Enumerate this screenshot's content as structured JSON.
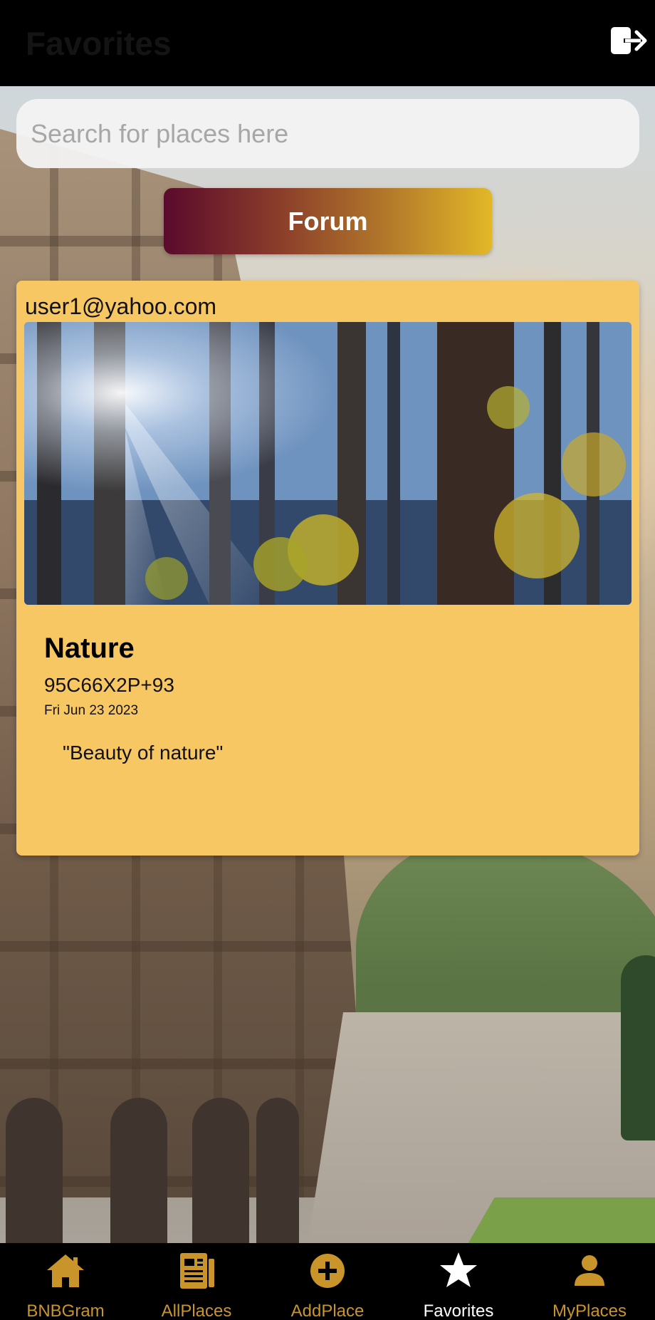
{
  "header": {
    "title": "Favorites",
    "logout_icon": "logout-icon"
  },
  "search": {
    "placeholder": "Search for places here",
    "value": ""
  },
  "forum_button": {
    "label": "Forum"
  },
  "post": {
    "user": "user1@yahoo.com",
    "title": "Nature",
    "plus_code": "95C66X2P+93",
    "date": "Fri Jun 23 2023",
    "description": "\"Beauty of nature\""
  },
  "bottom_nav": {
    "items": [
      {
        "label": "BNBGram",
        "icon": "home-icon",
        "active": false
      },
      {
        "label": "AllPlaces",
        "icon": "list-icon",
        "active": false
      },
      {
        "label": "AddPlace",
        "icon": "add-circle-icon",
        "active": false
      },
      {
        "label": "Favorites",
        "icon": "star-icon",
        "active": true
      },
      {
        "label": "MyPlaces",
        "icon": "person-icon",
        "active": false
      }
    ]
  },
  "colors": {
    "accent": "#c9952a",
    "card": "#f7c764",
    "active": "#ffffff"
  }
}
